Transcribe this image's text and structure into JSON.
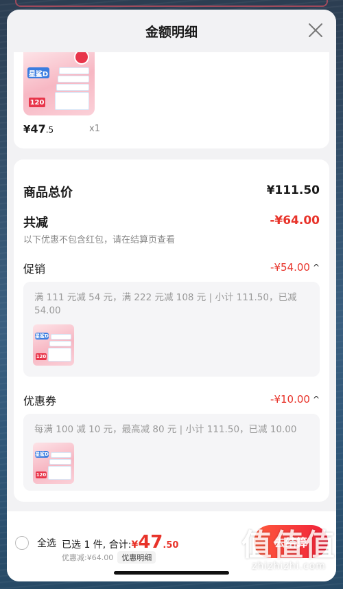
{
  "header": {
    "title": "金额明细"
  },
  "product": {
    "price_yen": "¥",
    "price_int": "47",
    "price_dec": ".5",
    "qty": "x1",
    "brand": "星鲨D",
    "pack_num": "120"
  },
  "summary": {
    "total_label": "商品总价",
    "total_value": "¥111.50",
    "reduce_label": "共减",
    "reduce_value": "-¥64.00",
    "note": "以下优惠不包含红包，请在结算页查看"
  },
  "promotion": {
    "label": "促销",
    "value": "-¥54.00",
    "chevron": "^",
    "detail": "满 111 元减 54 元，满 222 元减 108 元 | 小计 111.50，已减 54.00"
  },
  "coupon": {
    "label": "优惠券",
    "value": "-¥10.00",
    "chevron": "^",
    "detail": "每满 100 减 10 元，最高减 80 元 | 小计 111.50，已减 10.00"
  },
  "footer": {
    "select_all": "全选",
    "selected_text": "已选 1 件, 合计:",
    "yen": "¥",
    "total_int": "47",
    "total_dec": ".50",
    "discount_text": "优惠减:¥64.00",
    "detail_tag": "优惠明细",
    "checkout": "去结算"
  },
  "watermark": {
    "logo": "值值值",
    "text": "zhizhizhi.com"
  },
  "colors": {
    "accent": "#e8332a",
    "sheet_bg": "#f2f2f4",
    "card_bg": "#ffffff"
  },
  "icons": {
    "close": "close-icon",
    "radio": "radio-icon",
    "chevron": "chevron-up-icon"
  }
}
